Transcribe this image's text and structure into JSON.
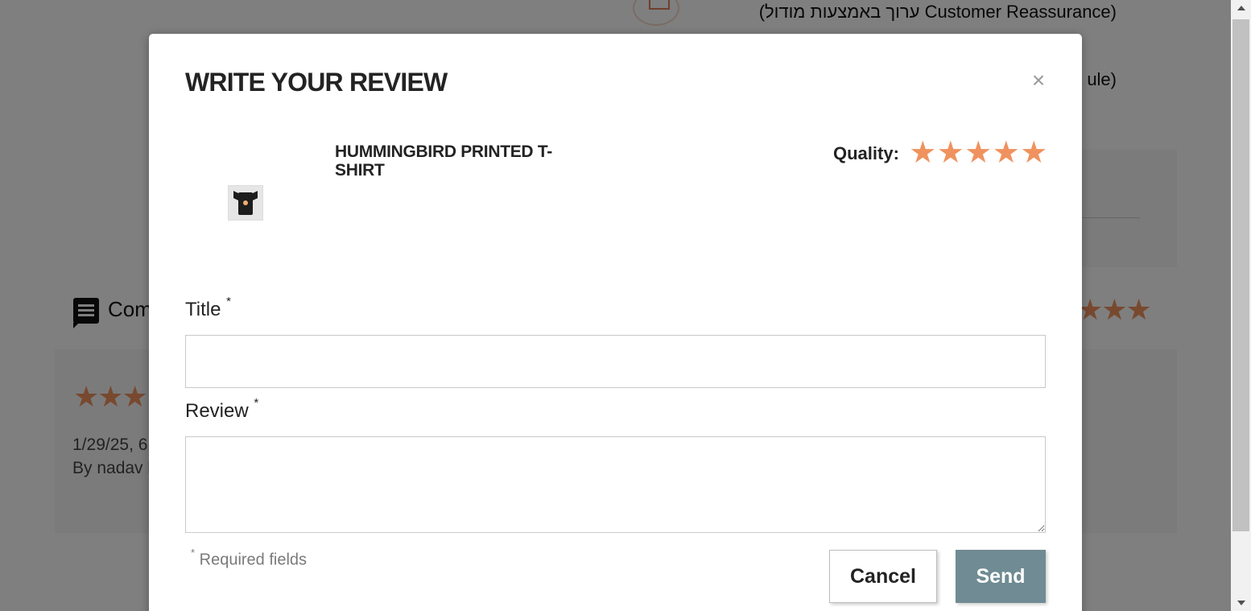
{
  "background": {
    "reassurance_line_1": "(ערוך באמצעות מודול Customer Reassurance)",
    "reassurance_line_2_fragment": "ule)",
    "comments_label_fragment": "Com",
    "review_card": {
      "stars": "★★★",
      "date_fragment": "1/29/25, 6",
      "author_fragment": "By nadav l"
    },
    "right_stars": "★★★"
  },
  "modal": {
    "title": "WRITE YOUR REVIEW",
    "close_label": "×",
    "product": {
      "name": "HUMMINGBIRD PRINTED T-SHIRT",
      "image_icon": "tshirt-thumbnail"
    },
    "criterion": {
      "label": "Quality:",
      "rating": 5,
      "max": 5,
      "star_glyph": "★"
    },
    "fields": {
      "title_label": "Title",
      "title_value": "",
      "review_label": "Review",
      "review_value": "",
      "required_marker": "*"
    },
    "required_note": "Required fields",
    "buttons": {
      "cancel": "Cancel",
      "send": "Send"
    }
  },
  "colors": {
    "star": "#f0925e",
    "send_button": "#708b93",
    "overlay": "rgba(0,0,0,0.5)"
  }
}
